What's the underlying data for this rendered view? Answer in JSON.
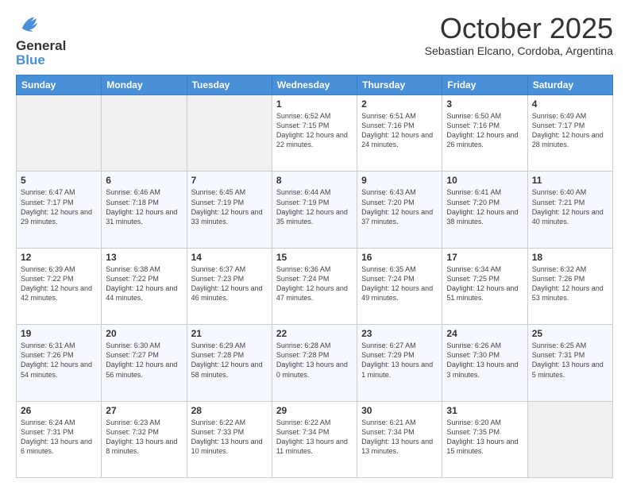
{
  "logo": {
    "line1": "General",
    "line2": "Blue"
  },
  "title": "October 2025",
  "subtitle": "Sebastian Elcano, Cordoba, Argentina",
  "days_of_week": [
    "Sunday",
    "Monday",
    "Tuesday",
    "Wednesday",
    "Thursday",
    "Friday",
    "Saturday"
  ],
  "weeks": [
    [
      {
        "num": "",
        "info": ""
      },
      {
        "num": "",
        "info": ""
      },
      {
        "num": "",
        "info": ""
      },
      {
        "num": "1",
        "info": "Sunrise: 6:52 AM\nSunset: 7:15 PM\nDaylight: 12 hours and 22 minutes."
      },
      {
        "num": "2",
        "info": "Sunrise: 6:51 AM\nSunset: 7:16 PM\nDaylight: 12 hours and 24 minutes."
      },
      {
        "num": "3",
        "info": "Sunrise: 6:50 AM\nSunset: 7:16 PM\nDaylight: 12 hours and 26 minutes."
      },
      {
        "num": "4",
        "info": "Sunrise: 6:49 AM\nSunset: 7:17 PM\nDaylight: 12 hours and 28 minutes."
      }
    ],
    [
      {
        "num": "5",
        "info": "Sunrise: 6:47 AM\nSunset: 7:17 PM\nDaylight: 12 hours and 29 minutes."
      },
      {
        "num": "6",
        "info": "Sunrise: 6:46 AM\nSunset: 7:18 PM\nDaylight: 12 hours and 31 minutes."
      },
      {
        "num": "7",
        "info": "Sunrise: 6:45 AM\nSunset: 7:19 PM\nDaylight: 12 hours and 33 minutes."
      },
      {
        "num": "8",
        "info": "Sunrise: 6:44 AM\nSunset: 7:19 PM\nDaylight: 12 hours and 35 minutes."
      },
      {
        "num": "9",
        "info": "Sunrise: 6:43 AM\nSunset: 7:20 PM\nDaylight: 12 hours and 37 minutes."
      },
      {
        "num": "10",
        "info": "Sunrise: 6:41 AM\nSunset: 7:20 PM\nDaylight: 12 hours and 38 minutes."
      },
      {
        "num": "11",
        "info": "Sunrise: 6:40 AM\nSunset: 7:21 PM\nDaylight: 12 hours and 40 minutes."
      }
    ],
    [
      {
        "num": "12",
        "info": "Sunrise: 6:39 AM\nSunset: 7:22 PM\nDaylight: 12 hours and 42 minutes."
      },
      {
        "num": "13",
        "info": "Sunrise: 6:38 AM\nSunset: 7:22 PM\nDaylight: 12 hours and 44 minutes."
      },
      {
        "num": "14",
        "info": "Sunrise: 6:37 AM\nSunset: 7:23 PM\nDaylight: 12 hours and 46 minutes."
      },
      {
        "num": "15",
        "info": "Sunrise: 6:36 AM\nSunset: 7:24 PM\nDaylight: 12 hours and 47 minutes."
      },
      {
        "num": "16",
        "info": "Sunrise: 6:35 AM\nSunset: 7:24 PM\nDaylight: 12 hours and 49 minutes."
      },
      {
        "num": "17",
        "info": "Sunrise: 6:34 AM\nSunset: 7:25 PM\nDaylight: 12 hours and 51 minutes."
      },
      {
        "num": "18",
        "info": "Sunrise: 6:32 AM\nSunset: 7:26 PM\nDaylight: 12 hours and 53 minutes."
      }
    ],
    [
      {
        "num": "19",
        "info": "Sunrise: 6:31 AM\nSunset: 7:26 PM\nDaylight: 12 hours and 54 minutes."
      },
      {
        "num": "20",
        "info": "Sunrise: 6:30 AM\nSunset: 7:27 PM\nDaylight: 12 hours and 56 minutes."
      },
      {
        "num": "21",
        "info": "Sunrise: 6:29 AM\nSunset: 7:28 PM\nDaylight: 12 hours and 58 minutes."
      },
      {
        "num": "22",
        "info": "Sunrise: 6:28 AM\nSunset: 7:28 PM\nDaylight: 13 hours and 0 minutes."
      },
      {
        "num": "23",
        "info": "Sunrise: 6:27 AM\nSunset: 7:29 PM\nDaylight: 13 hours and 1 minute."
      },
      {
        "num": "24",
        "info": "Sunrise: 6:26 AM\nSunset: 7:30 PM\nDaylight: 13 hours and 3 minutes."
      },
      {
        "num": "25",
        "info": "Sunrise: 6:25 AM\nSunset: 7:31 PM\nDaylight: 13 hours and 5 minutes."
      }
    ],
    [
      {
        "num": "26",
        "info": "Sunrise: 6:24 AM\nSunset: 7:31 PM\nDaylight: 13 hours and 6 minutes."
      },
      {
        "num": "27",
        "info": "Sunrise: 6:23 AM\nSunset: 7:32 PM\nDaylight: 13 hours and 8 minutes."
      },
      {
        "num": "28",
        "info": "Sunrise: 6:22 AM\nSunset: 7:33 PM\nDaylight: 13 hours and 10 minutes."
      },
      {
        "num": "29",
        "info": "Sunrise: 6:22 AM\nSunset: 7:34 PM\nDaylight: 13 hours and 11 minutes."
      },
      {
        "num": "30",
        "info": "Sunrise: 6:21 AM\nSunset: 7:34 PM\nDaylight: 13 hours and 13 minutes."
      },
      {
        "num": "31",
        "info": "Sunrise: 6:20 AM\nSunset: 7:35 PM\nDaylight: 13 hours and 15 minutes."
      },
      {
        "num": "",
        "info": ""
      }
    ]
  ]
}
